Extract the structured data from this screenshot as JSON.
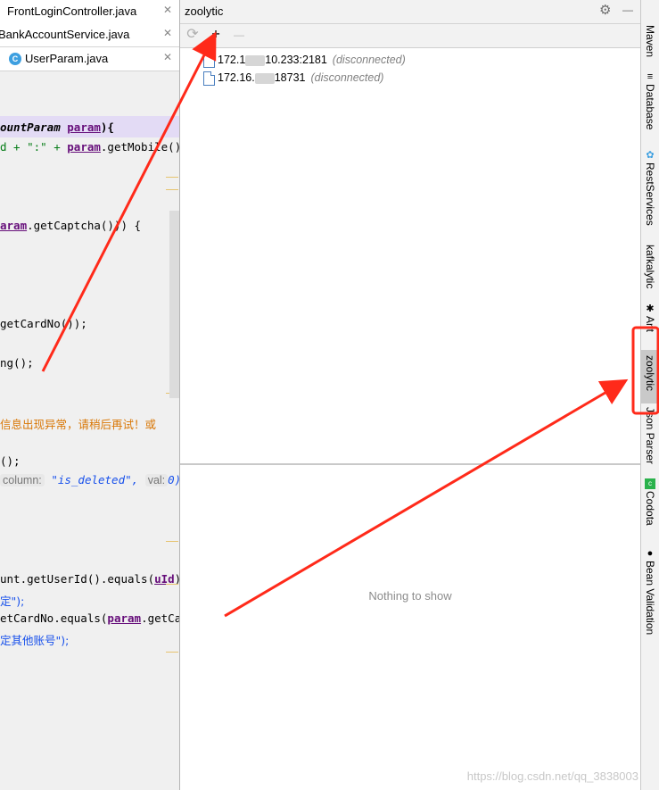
{
  "editor": {
    "tabs": [
      {
        "label": "FrontLoginController.java"
      },
      {
        "label": "BankAccountService.java"
      },
      {
        "label": "UserParam.java",
        "icon": "C"
      }
    ],
    "close_glyph": "✕",
    "code": {
      "l1_a": "ountParam ",
      "l1_b": "param",
      "l1_c": "){",
      "l2_a": "d + \":\" + ",
      "l2_b": "param",
      "l2_c": ".getMobile());",
      "l3_a": "aram",
      "l3_b": ".getCaptcha())) {",
      "l4": "getCardNo());",
      "l5": "ng();",
      "l6": "​信息出现异常，请稍后再试！或",
      "l7": "();",
      "l8_hint": "column:",
      "l8_val": "\"is_deleted\",",
      "l8_hint2": "val:",
      "l8_num": "0)",
      "l9_a": "unt.getUserId().equals(",
      "l9_b": "uId",
      "l9_c": ")",
      "l10": "定\");",
      "l11_a": "etCardNo.equals(",
      "l11_b": "param",
      "l11_c": ".getCard",
      "l12": "定其他账号\");"
    }
  },
  "panel": {
    "title": "zoolytic",
    "settings_glyph": "⚙",
    "minimize_glyph": "—",
    "toolbar": {
      "refresh": "⟳",
      "add": "+",
      "remove": "—"
    },
    "connections": [
      {
        "host_a": "172.1",
        "host_b": "10.233:2181",
        "status": "(disconnected)"
      },
      {
        "host_a": "172.16.",
        "host_b": "18731",
        "status": "(disconnected)"
      }
    ],
    "empty_text": "Nothing to show",
    "watermark": "https://blog.csdn.net/qq_3838003"
  },
  "tool_strip": [
    {
      "label": "Maven",
      "icon": "maven-icon"
    },
    {
      "label": "Database",
      "icon": "database-icon"
    },
    {
      "label": "RestServices",
      "icon": "rest-icon"
    },
    {
      "label": "kafkalytic",
      "icon": ""
    },
    {
      "label": "Ant",
      "icon": "ant-icon"
    },
    {
      "label": "zoolytic",
      "icon": "",
      "active": true
    },
    {
      "label": "Json Parser",
      "icon": ""
    },
    {
      "label": "Codota",
      "icon": "codota-icon"
    },
    {
      "label": "Bean Validation",
      "icon": "bean-icon"
    }
  ],
  "colors": {
    "arrow": "#ff2a1a",
    "highlight_box": "#ff2a1a",
    "accent": "#3d9fe0"
  }
}
